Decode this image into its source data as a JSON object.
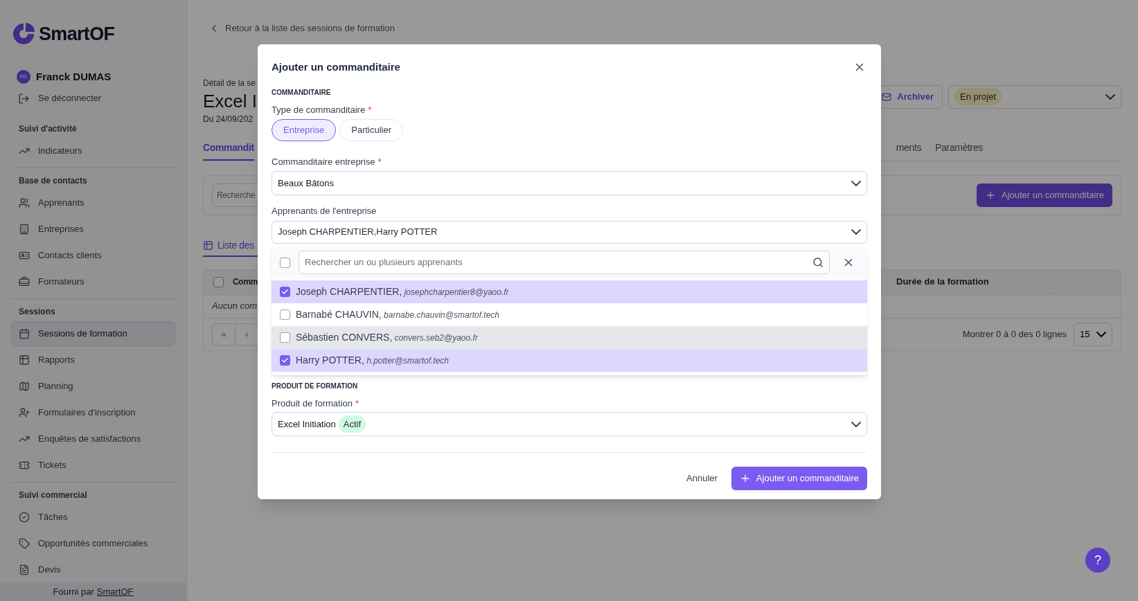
{
  "sidebar": {
    "logo_text": "SmartOF",
    "user": {
      "initials": "FD",
      "name": "Franck DUMAS"
    },
    "logout": "Se déconnecter",
    "sections": [
      {
        "title": "Suivi d'activité",
        "items": [
          {
            "label": "Indicateurs",
            "selected": false
          }
        ]
      },
      {
        "title": "Base de contacts",
        "items": [
          {
            "label": "Apprenants",
            "selected": false
          },
          {
            "label": "Entreprises",
            "selected": false
          },
          {
            "label": "Contacts clients",
            "selected": false
          },
          {
            "label": "Formateurs",
            "selected": false
          }
        ]
      },
      {
        "title": "Sessions",
        "items": [
          {
            "label": "Sessions de formation",
            "selected": true
          },
          {
            "label": "Rapports",
            "selected": false
          },
          {
            "label": "Planning",
            "selected": false
          },
          {
            "label": "Formulaires d'inscription",
            "selected": false
          },
          {
            "label": "Enquêtes de satisfactions",
            "selected": false
          },
          {
            "label": "Tickets",
            "selected": false
          }
        ]
      },
      {
        "title": "Suivi commercial",
        "items": [
          {
            "label": "Tâches",
            "selected": false
          },
          {
            "label": "Opportunités commerciales",
            "selected": false
          },
          {
            "label": "Devis",
            "selected": false
          }
        ]
      }
    ],
    "footer": {
      "prefix": "Fourni par",
      "link": "SmartOF"
    }
  },
  "main": {
    "back_link": "Retour à la liste des sessions de formation",
    "subtitle": "Détail de la se",
    "title": "Excel I",
    "dates": "Du 24/09/202",
    "archive_button": "Archiver",
    "status": "En projet",
    "tabs": [
      {
        "label": "Commandit",
        "selected": true
      },
      {
        "label": "ments",
        "selected": false
      },
      {
        "label": "Paramètres",
        "selected": false
      }
    ],
    "search_placeholder": "Recherche",
    "add_button": "Ajouter un commanditaire",
    "list_tab": "Liste des",
    "table": {
      "select_all_checked": false,
      "columns": [
        "Comm",
        "Durée de la formation"
      ],
      "empty": "Aucun com"
    },
    "pagination": {
      "first": "«",
      "prev": "‹",
      "summary": "Montrer 0 à 0 des 0 lignes",
      "page_size": "15"
    }
  },
  "modal": {
    "title": "Ajouter un commanditaire",
    "section_1": "COMMANDITAIRE",
    "type_label": "Type de commanditaire",
    "required": "*",
    "types": [
      {
        "label": "Entreprise",
        "selected": true
      },
      {
        "label": "Particulier",
        "selected": false
      }
    ],
    "company_label": "Commanditaire entreprise",
    "company_value": "Beaux Bâtons",
    "learners_label": "Apprenants de l'entreprise",
    "learners_value": "Joseph CHARPENTIER,Harry POTTER",
    "dropdown": {
      "select_all_checked": false,
      "search_placeholder": "Rechercher un ou plusieurs apprenants",
      "options": [
        {
          "name": "Joseph CHARPENTIER",
          "separator": ",",
          "email": "josephcharpentier8@yaoo.fr",
          "checked": true,
          "hovered": false
        },
        {
          "name": "Barnabé CHAUVIN",
          "separator": ",",
          "email": "barnabe.chauvin@smartof.tech",
          "checked": false,
          "hovered": false
        },
        {
          "name": "Sébastien CONVERS",
          "separator": ",",
          "email": "convers.seb2@yaoo.fr",
          "checked": false,
          "hovered": true
        },
        {
          "name": "Harry POTTER",
          "separator": ",",
          "email": "h.potter@smartof.tech",
          "checked": true,
          "hovered": false
        }
      ]
    },
    "section_2": "PRODUIT DE FORMATION",
    "product_label": "Produit de formation",
    "product_value": "Excel Initiation",
    "product_badge": "Actif",
    "cancel": "Annuler",
    "submit": "Ajouter un commanditaire"
  },
  "help_button": "?"
}
